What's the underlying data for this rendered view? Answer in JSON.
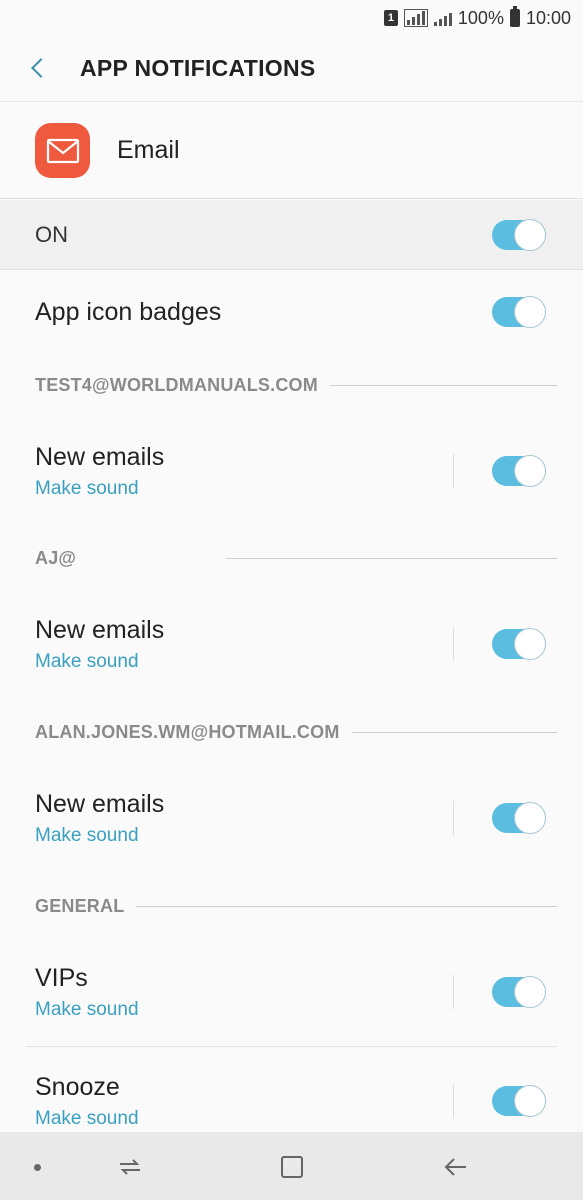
{
  "status_bar": {
    "sim_label": "1",
    "battery_text": "100%",
    "time": "10:00"
  },
  "header": {
    "title": "APP NOTIFICATIONS",
    "back_icon": "back-arrow-icon"
  },
  "app": {
    "name": "Email",
    "icon": "email-envelope-icon",
    "icon_color": "#ef5a3e"
  },
  "master": {
    "label": "ON",
    "enabled": true
  },
  "badges": {
    "label": "App icon badges",
    "enabled": true
  },
  "accounts": [
    {
      "section_label": "TEST4@WORLDMANUALS.COM",
      "item_title": "New emails",
      "item_sub": "Make sound",
      "enabled": true
    },
    {
      "section_label": "AJ@",
      "item_title": "New emails",
      "item_sub": "Make sound",
      "enabled": true
    },
    {
      "section_label": "ALAN.JONES.WM@HOTMAIL.COM",
      "item_title": "New emails",
      "item_sub": "Make sound",
      "enabled": true
    }
  ],
  "general": {
    "section_label": "GENERAL",
    "items": [
      {
        "title": "VIPs",
        "sub": "Make sound",
        "enabled": true
      },
      {
        "title": "Snooze",
        "sub": "Make sound",
        "enabled": true
      }
    ]
  },
  "colors": {
    "accent": "#5bbde0",
    "link": "#3a9fc0",
    "nav_bar": "#e9e9e9"
  }
}
